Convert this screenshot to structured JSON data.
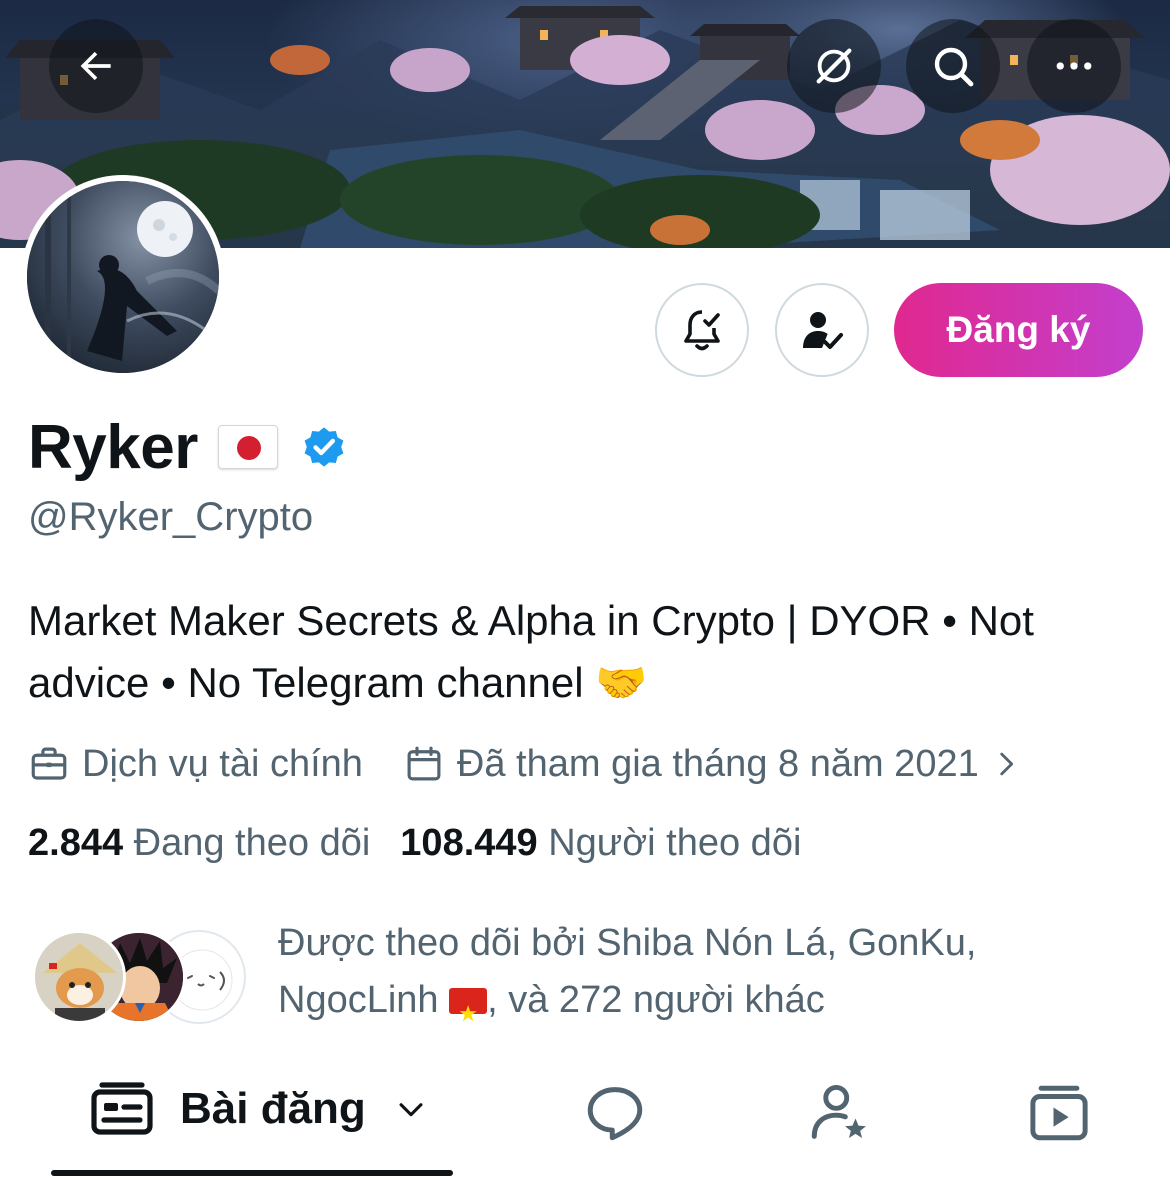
{
  "profile": {
    "name": "Ryker",
    "handle": "@Ryker_Crypto",
    "bio_line1": "Market Maker Secrets & Alpha in Crypto | DYOR • Not",
    "bio_line2": "advice • No Telegram channel 🤝",
    "category": "Dịch vụ tài chính",
    "joined": "Đã tham gia tháng 8 năm 2021",
    "verified": true,
    "name_flag": "japan-flag"
  },
  "actions": {
    "subscribe_label": "Đăng ký",
    "subscribe_color": "#e0288f",
    "subscribe_color_end": "#c33fcd"
  },
  "stats": {
    "following_count": "2.844",
    "following_label": "Đang theo dõi",
    "followers_count": "108.449",
    "followers_label": "Người theo dõi"
  },
  "followed_by": {
    "line1": "Được theo dõi bởi Shiba Nón Lá, GonKu,",
    "line2_name": "NgocLinh",
    "line2_rest": ", và 272 người khác"
  },
  "tabs": {
    "posts_label": "Bài đăng",
    "items": [
      "posts-tab",
      "replies-tab",
      "highlights-tab",
      "media-tab"
    ]
  },
  "icons": {
    "back": "arrow-left-icon",
    "grok": "grok-icon",
    "search": "search-icon",
    "more": "more-icon",
    "notifications": "bell-check-icon",
    "following": "user-check-icon",
    "verified": "verified-badge-icon",
    "category": "briefcase-icon",
    "joined": "calendar-icon"
  },
  "colors": {
    "secondary_text": "#536471",
    "primary_text": "#0f1419",
    "verified_blue": "#1d9bf0"
  }
}
